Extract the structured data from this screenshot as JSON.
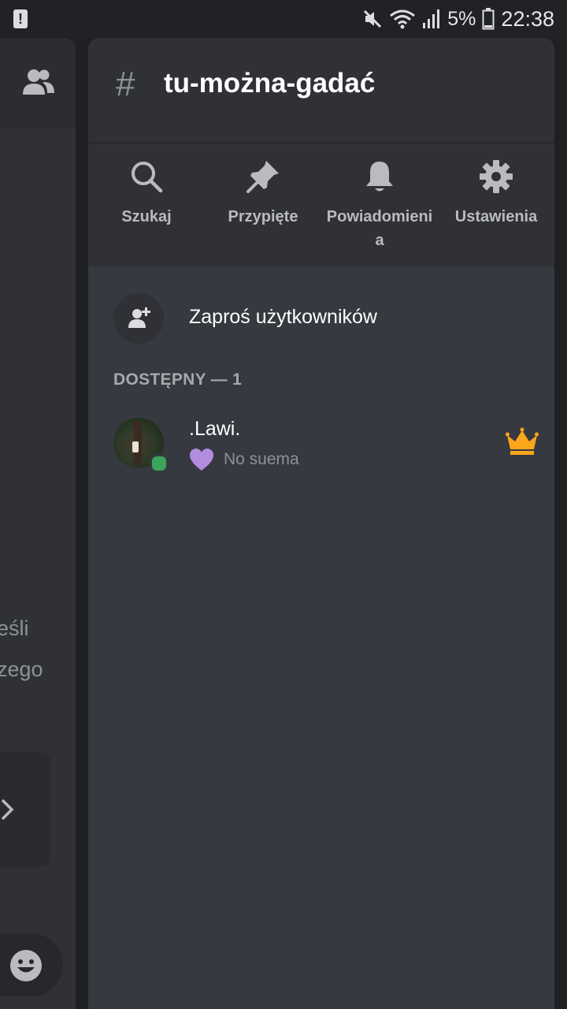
{
  "status_bar": {
    "battery_percent": "5%",
    "time": "22:38",
    "icons": [
      "alert-icon",
      "mute-icon",
      "wifi-icon",
      "signal-icon",
      "battery-icon"
    ]
  },
  "left_panel": {
    "text_lines": [
      "eśli",
      "zego"
    ],
    "icons": [
      "members-icon",
      "chevron-right-icon",
      "emoji-icon"
    ]
  },
  "channel": {
    "hash_symbol": "#",
    "name": "tu-można-gadać"
  },
  "actions": [
    {
      "label": "Szukaj",
      "icon": "search-icon"
    },
    {
      "label": "Przypięte",
      "icon": "pin-icon"
    },
    {
      "label": "Powiadomienia",
      "icon": "bell-icon"
    },
    {
      "label": "Ustawienia",
      "icon": "gear-icon"
    }
  ],
  "invite": {
    "label": "Zaproś użytkowników",
    "icon": "add-user-icon"
  },
  "members_section": {
    "header": "DOSTĘPNY — 1"
  },
  "members": [
    {
      "name": ".Lawi.",
      "status_text": "No suema",
      "status_emoji": "purple-heart-icon",
      "presence": "online",
      "badge": "crown-icon"
    }
  ],
  "colors": {
    "drawer_bg": "#36393f",
    "header_bg": "#2f3136",
    "online": "#3ba55d",
    "crown": "#faa61a",
    "heart": "#b18cdf"
  }
}
